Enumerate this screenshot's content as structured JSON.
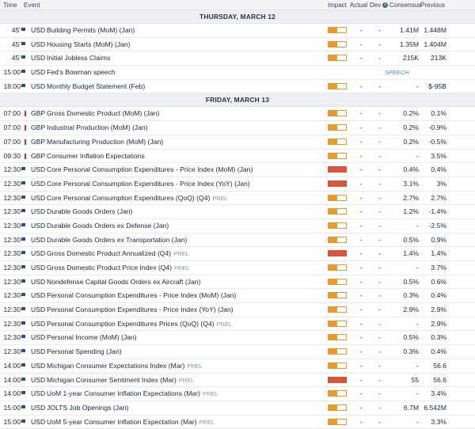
{
  "header": {
    "time": "Time",
    "event": "Event",
    "impact": "Impact",
    "actual": "Actual",
    "dev": "Dev",
    "consensus": "Consensus",
    "previous": "Previous"
  },
  "colors": {
    "impact_medium": "#e27c17",
    "impact_high": "#d9553f",
    "speech": "#4a8fd4"
  },
  "sections": [
    {
      "title": "THURSDAY, MARCH 12",
      "rows": [
        {
          "time": "45'",
          "flag": "us-flag",
          "currency": "USD",
          "event": "Building Permits (MoM) (Jan)",
          "tag": "",
          "impact": "medium",
          "impact_level": 0.5,
          "actual": "-",
          "dev": "-",
          "consensus": "1.41M",
          "previous": "1.448M"
        },
        {
          "time": "45'",
          "flag": "us-flag",
          "currency": "USD",
          "event": "Housing Starts (MoM) (Jan)",
          "tag": "",
          "impact": "medium",
          "impact_level": 0.5,
          "actual": "-",
          "dev": "-",
          "consensus": "1.35M",
          "previous": "1.404M"
        },
        {
          "time": "45'",
          "flag": "us-flag",
          "currency": "USD",
          "event": "Initial Jobless Claims",
          "tag": "",
          "impact": "medium",
          "impact_level": 0.5,
          "actual": "-",
          "dev": "-",
          "consensus": "215K",
          "previous": "213K"
        },
        {
          "time": "15:00",
          "flag": "us-flag",
          "currency": "USD",
          "event": "Fed's Bowman speech",
          "tag": "",
          "impact": "speech",
          "speech_label": "SPEECH",
          "actual": "",
          "dev": "",
          "consensus": "",
          "previous": ""
        },
        {
          "time": "18:00",
          "flag": "us-flag",
          "currency": "USD",
          "event": "Monthly Budget Statement (Feb)",
          "tag": "",
          "impact": "medium",
          "impact_level": 0.5,
          "actual": "-",
          "dev": "-",
          "consensus": "-",
          "previous": "$-95B"
        }
      ]
    },
    {
      "title": "FRIDAY, MARCH 13",
      "rows": [
        {
          "time": "07:00",
          "flag": "gb-flag",
          "currency": "GBP",
          "event": "Gross Domestic Product (MoM) (Jan)",
          "tag": "",
          "impact": "medium",
          "impact_level": 0.5,
          "actual": "-",
          "dev": "-",
          "consensus": "0.2%",
          "previous": "0.1%"
        },
        {
          "time": "07:00",
          "flag": "gb-flag",
          "currency": "GBP",
          "event": "Industrial Production (MoM) (Jan)",
          "tag": "",
          "impact": "medium",
          "impact_level": 0.5,
          "actual": "-",
          "dev": "-",
          "consensus": "0.2%",
          "previous": "-0.9%"
        },
        {
          "time": "07:00",
          "flag": "gb-flag",
          "currency": "GBP",
          "event": "Manufacturing Production (MoM) (Jan)",
          "tag": "",
          "impact": "medium",
          "impact_level": 0.5,
          "actual": "-",
          "dev": "-",
          "consensus": "0.2%",
          "previous": "-0.5%"
        },
        {
          "time": "09:30",
          "flag": "gb-flag",
          "currency": "GBP",
          "event": "Consumer Inflation Expectations",
          "tag": "",
          "impact": "medium",
          "impact_level": 0.5,
          "actual": "-",
          "dev": "-",
          "consensus": "-",
          "previous": "3.5%"
        },
        {
          "time": "12:30",
          "flag": "us-flag",
          "currency": "USD",
          "event": "Core Personal Consumption Expenditures - Price Index (MoM) (Jan)",
          "tag": "",
          "impact": "high",
          "impact_level": 1,
          "actual": "-",
          "dev": "-",
          "consensus": "0.4%",
          "previous": "0.4%"
        },
        {
          "time": "12:30",
          "flag": "us-flag",
          "currency": "USD",
          "event": "Core Personal Consumption Expenditures - Price Index (YoY) (Jan)",
          "tag": "",
          "impact": "high",
          "impact_level": 1,
          "actual": "-",
          "dev": "-",
          "consensus": "3.1%",
          "previous": "3%"
        },
        {
          "time": "12:30",
          "flag": "us-flag",
          "currency": "USD",
          "event": "Core Personal Consumption Expenditures (QoQ) (Q4)",
          "tag": "PREL",
          "impact": "medium",
          "impact_level": 0.5,
          "actual": "-",
          "dev": "-",
          "consensus": "2.7%",
          "previous": "2.7%"
        },
        {
          "time": "12:30",
          "flag": "us-flag",
          "currency": "USD",
          "event": "Durable Goods Orders (Jan)",
          "tag": "",
          "impact": "medium",
          "impact_level": 0.5,
          "actual": "-",
          "dev": "-",
          "consensus": "1.2%",
          "previous": "-1.4%"
        },
        {
          "time": "12:30",
          "flag": "us-flag",
          "currency": "USD",
          "event": "Durable Goods Orders ex Defense (Jan)",
          "tag": "",
          "impact": "medium",
          "impact_level": 0.5,
          "actual": "-",
          "dev": "-",
          "consensus": "-",
          "previous": "-2.5%"
        },
        {
          "time": "12:30",
          "flag": "us-flag",
          "currency": "USD",
          "event": "Durable Goods Orders ex Transportation (Jan)",
          "tag": "",
          "impact": "medium",
          "impact_level": 0.5,
          "actual": "-",
          "dev": "-",
          "consensus": "0.5%",
          "previous": "0.9%"
        },
        {
          "time": "12:30",
          "flag": "us-flag",
          "currency": "USD",
          "event": "Gross Domestic Product Annualized (Q4)",
          "tag": "PREL",
          "impact": "high",
          "impact_level": 1,
          "actual": "-",
          "dev": "-",
          "consensus": "1.4%",
          "previous": "1.4%"
        },
        {
          "time": "12:30",
          "flag": "us-flag",
          "currency": "USD",
          "event": "Gross Domestic Product Price Index (Q4)",
          "tag": "PREL",
          "impact": "medium",
          "impact_level": 0.5,
          "actual": "-",
          "dev": "-",
          "consensus": "-",
          "previous": "3.7%"
        },
        {
          "time": "12:30",
          "flag": "us-flag",
          "currency": "USD",
          "event": "Nondefense Capital Goods Orders ex Aircraft (Jan)",
          "tag": "",
          "impact": "medium",
          "impact_level": 0.5,
          "actual": "-",
          "dev": "-",
          "consensus": "0.5%",
          "previous": "0.6%"
        },
        {
          "time": "12:30",
          "flag": "us-flag",
          "currency": "USD",
          "event": "Personal Consumption Expenditures - Price Index (MoM) (Jan)",
          "tag": "",
          "impact": "medium",
          "impact_level": 0.5,
          "actual": "-",
          "dev": "-",
          "consensus": "0.3%",
          "previous": "0.4%"
        },
        {
          "time": "12:30",
          "flag": "us-flag",
          "currency": "USD",
          "event": "Personal Consumption Expenditures - Price Index (YoY) (Jan)",
          "tag": "",
          "impact": "medium",
          "impact_level": 0.5,
          "actual": "-",
          "dev": "-",
          "consensus": "2.9%",
          "previous": "2.9%"
        },
        {
          "time": "12:30",
          "flag": "us-flag",
          "currency": "USD",
          "event": "Personal Consumption Expenditures Prices (QoQ) (Q4)",
          "tag": "PREL",
          "impact": "medium",
          "impact_level": 0.5,
          "actual": "-",
          "dev": "-",
          "consensus": "-",
          "previous": "2.9%"
        },
        {
          "time": "12:30",
          "flag": "us-flag",
          "currency": "USD",
          "event": "Personal Income (MoM) (Jan)",
          "tag": "",
          "impact": "medium",
          "impact_level": 0.5,
          "actual": "-",
          "dev": "-",
          "consensus": "0.5%",
          "previous": "0.3%"
        },
        {
          "time": "12:30",
          "flag": "us-flag",
          "currency": "USD",
          "event": "Personal Spending (Jan)",
          "tag": "",
          "impact": "medium",
          "impact_level": 0.5,
          "actual": "-",
          "dev": "-",
          "consensus": "0.3%",
          "previous": "0.4%"
        },
        {
          "time": "14:00",
          "flag": "us-flag",
          "currency": "USD",
          "event": "Michigan Consumer Expectations Index (Mar)",
          "tag": "PREL",
          "impact": "medium",
          "impact_level": 0.5,
          "actual": "-",
          "dev": "-",
          "consensus": "-",
          "previous": "56.6"
        },
        {
          "time": "14:00",
          "flag": "us-flag",
          "currency": "USD",
          "event": "Michigan Consumer Sentiment Index (Mar)",
          "tag": "PREL",
          "impact": "high",
          "impact_level": 1,
          "actual": "-",
          "dev": "-",
          "consensus": "55",
          "previous": "56.6"
        },
        {
          "time": "14:00",
          "flag": "us-flag",
          "currency": "USD",
          "event": "UoM 1-year Consumer Inflation Expectations (Mar)",
          "tag": "PREL",
          "impact": "medium",
          "impact_level": 0.5,
          "actual": "-",
          "dev": "-",
          "consensus": "-",
          "previous": "3.4%"
        },
        {
          "time": "15:00",
          "flag": "us-flag",
          "currency": "USD",
          "event": "JOLTS Job Openings (Jan)",
          "tag": "",
          "impact": "medium",
          "impact_level": 0.5,
          "actual": "-",
          "dev": "-",
          "consensus": "6.7M",
          "previous": "6.542M"
        },
        {
          "time": "15:00",
          "flag": "us-flag",
          "currency": "USD",
          "event": "UoM 5-year Consumer Inflation Expectation (Mar)",
          "tag": "PREL",
          "impact": "medium",
          "impact_level": 0.5,
          "actual": "-",
          "dev": "-",
          "consensus": "-",
          "previous": "3.3%"
        }
      ]
    }
  ]
}
